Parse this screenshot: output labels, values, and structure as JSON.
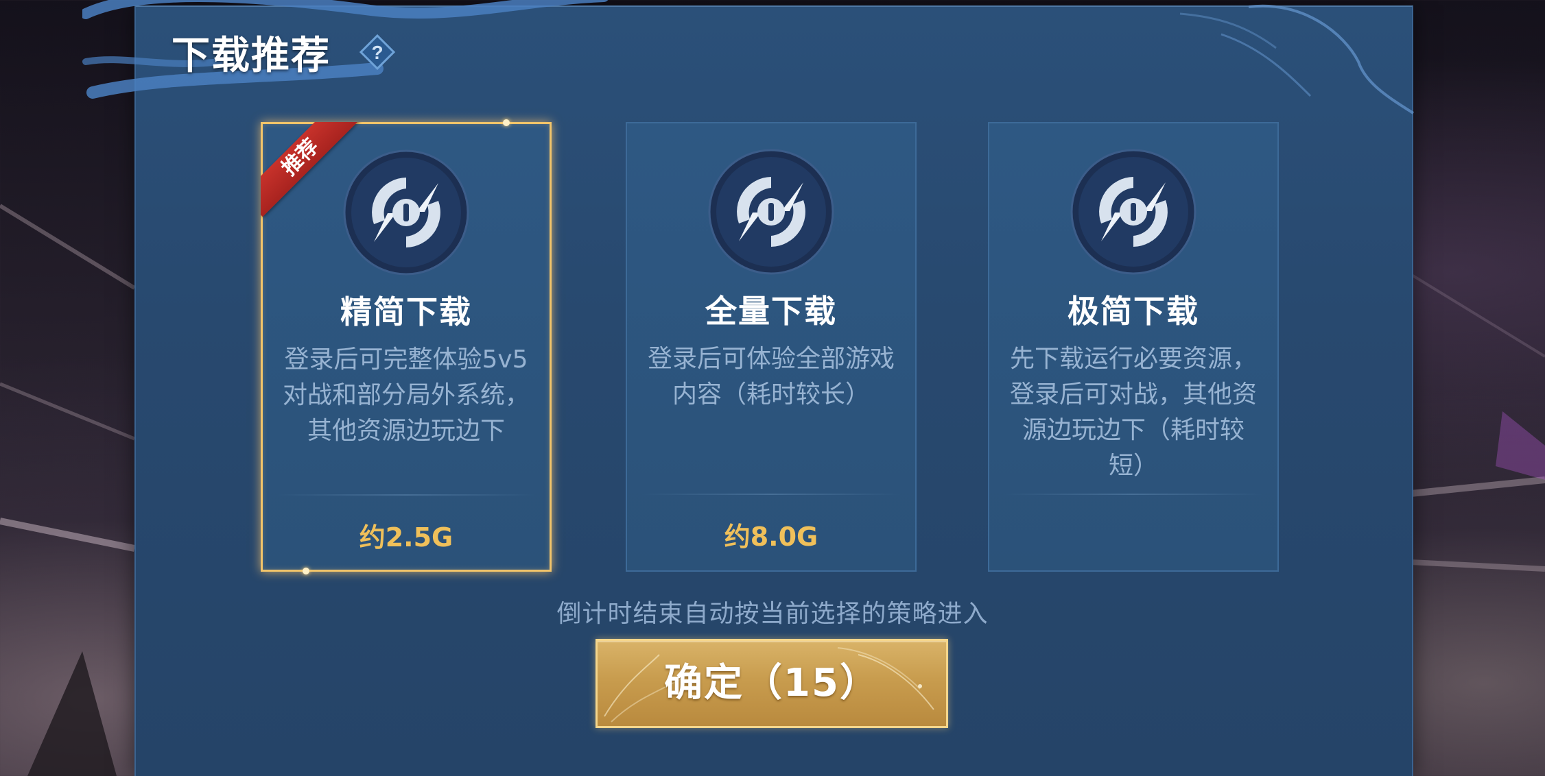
{
  "dialog": {
    "title": "下载推荐",
    "help_icon": "question-diamond-icon"
  },
  "options": [
    {
      "ribbon": "推荐",
      "title": "精简下载",
      "description": "登录后可完整体验5v5对战和部分局外系统，其他资源边玩边下",
      "size": "约2.5G",
      "selected": true,
      "icon": "download-emblem-icon"
    },
    {
      "title": "全量下载",
      "description": "登录后可体验全部游戏内容（耗时较长）",
      "size": "约8.0G",
      "selected": false,
      "icon": "download-emblem-icon"
    },
    {
      "title": "极简下载",
      "description": "先下载运行必要资源，登录后可对战，其他资源边玩边下（耗时较短）",
      "size": "",
      "selected": false,
      "icon": "download-emblem-icon"
    }
  ],
  "hint": "倒计时结束自动按当前选择的策略进入",
  "confirm_button": {
    "label": "确定（15）"
  },
  "colors": {
    "panel": "#28496f",
    "selected_border": "#f1c46a",
    "size_text": "#f0c05a",
    "ribbon": "#c7322b",
    "button": "#c89c4e"
  }
}
